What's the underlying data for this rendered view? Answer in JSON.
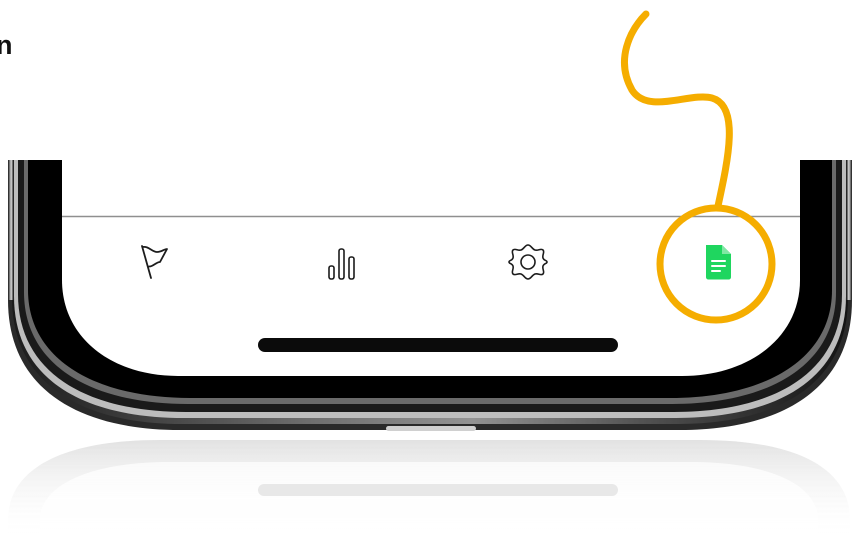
{
  "header": {
    "partial_title": "n"
  },
  "tab_bar": {
    "items": [
      {
        "icon": "flag-icon",
        "active": false
      },
      {
        "icon": "bar-chart-icon",
        "active": false
      },
      {
        "icon": "gear-icon",
        "active": false
      },
      {
        "icon": "document-icon",
        "active": true
      }
    ]
  },
  "annotation": {
    "highlight_color": "#f5ad00",
    "highlighted_tab": "document-icon"
  },
  "colors": {
    "active_icon": "#1fd65f",
    "inactive_icon": "#1c1c1c"
  }
}
